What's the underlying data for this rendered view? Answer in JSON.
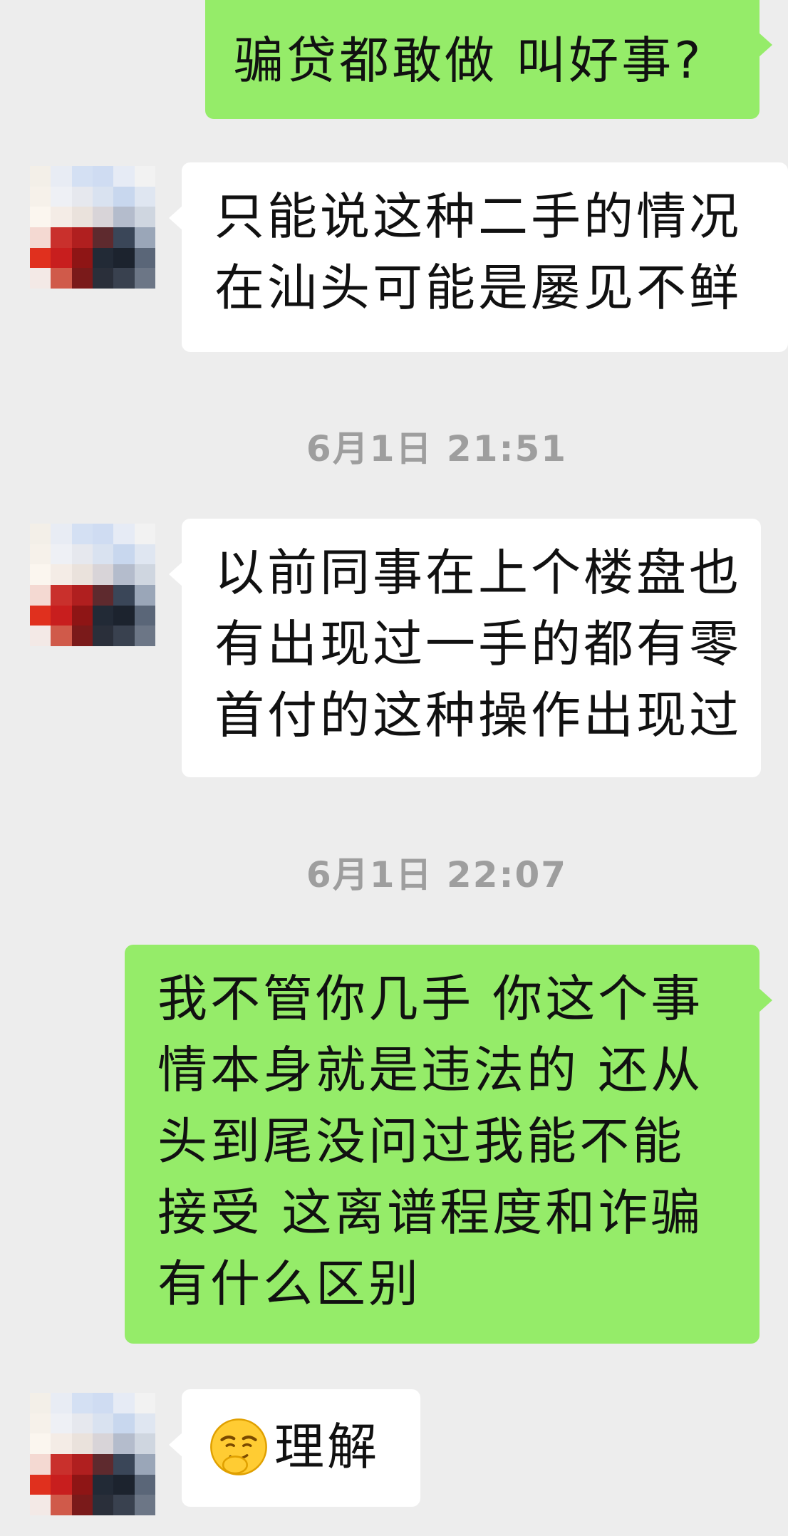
{
  "messages": {
    "m1": {
      "lines": [
        "骗贷都敢做  叫好事?"
      ]
    },
    "m2": {
      "lines": [
        "只能说这种二手的情况",
        "在汕头可能是屡见不鲜"
      ]
    },
    "m3": {
      "lines": [
        "以前同事在上个楼盘也",
        "有出现过一手的都有零",
        "首付的这种操作出现过"
      ]
    },
    "m4": {
      "lines": [
        "我不管你几手 你这个事",
        "情本身就是违法的 还从",
        "头到尾没问过我能不能",
        "接受 这离谱程度和诈骗",
        "有什么区别"
      ]
    },
    "m5": {
      "emoji": "smirk-face",
      "text": "理解"
    }
  },
  "timestamps": {
    "t1": "6月1日 21:51",
    "t2": "6月1日 22:07"
  },
  "colors": {
    "background": "#ededed",
    "sent_bubble": "#95ec69",
    "received_bubble": "#ffffff",
    "timestamp_text": "#9e9e9e"
  }
}
